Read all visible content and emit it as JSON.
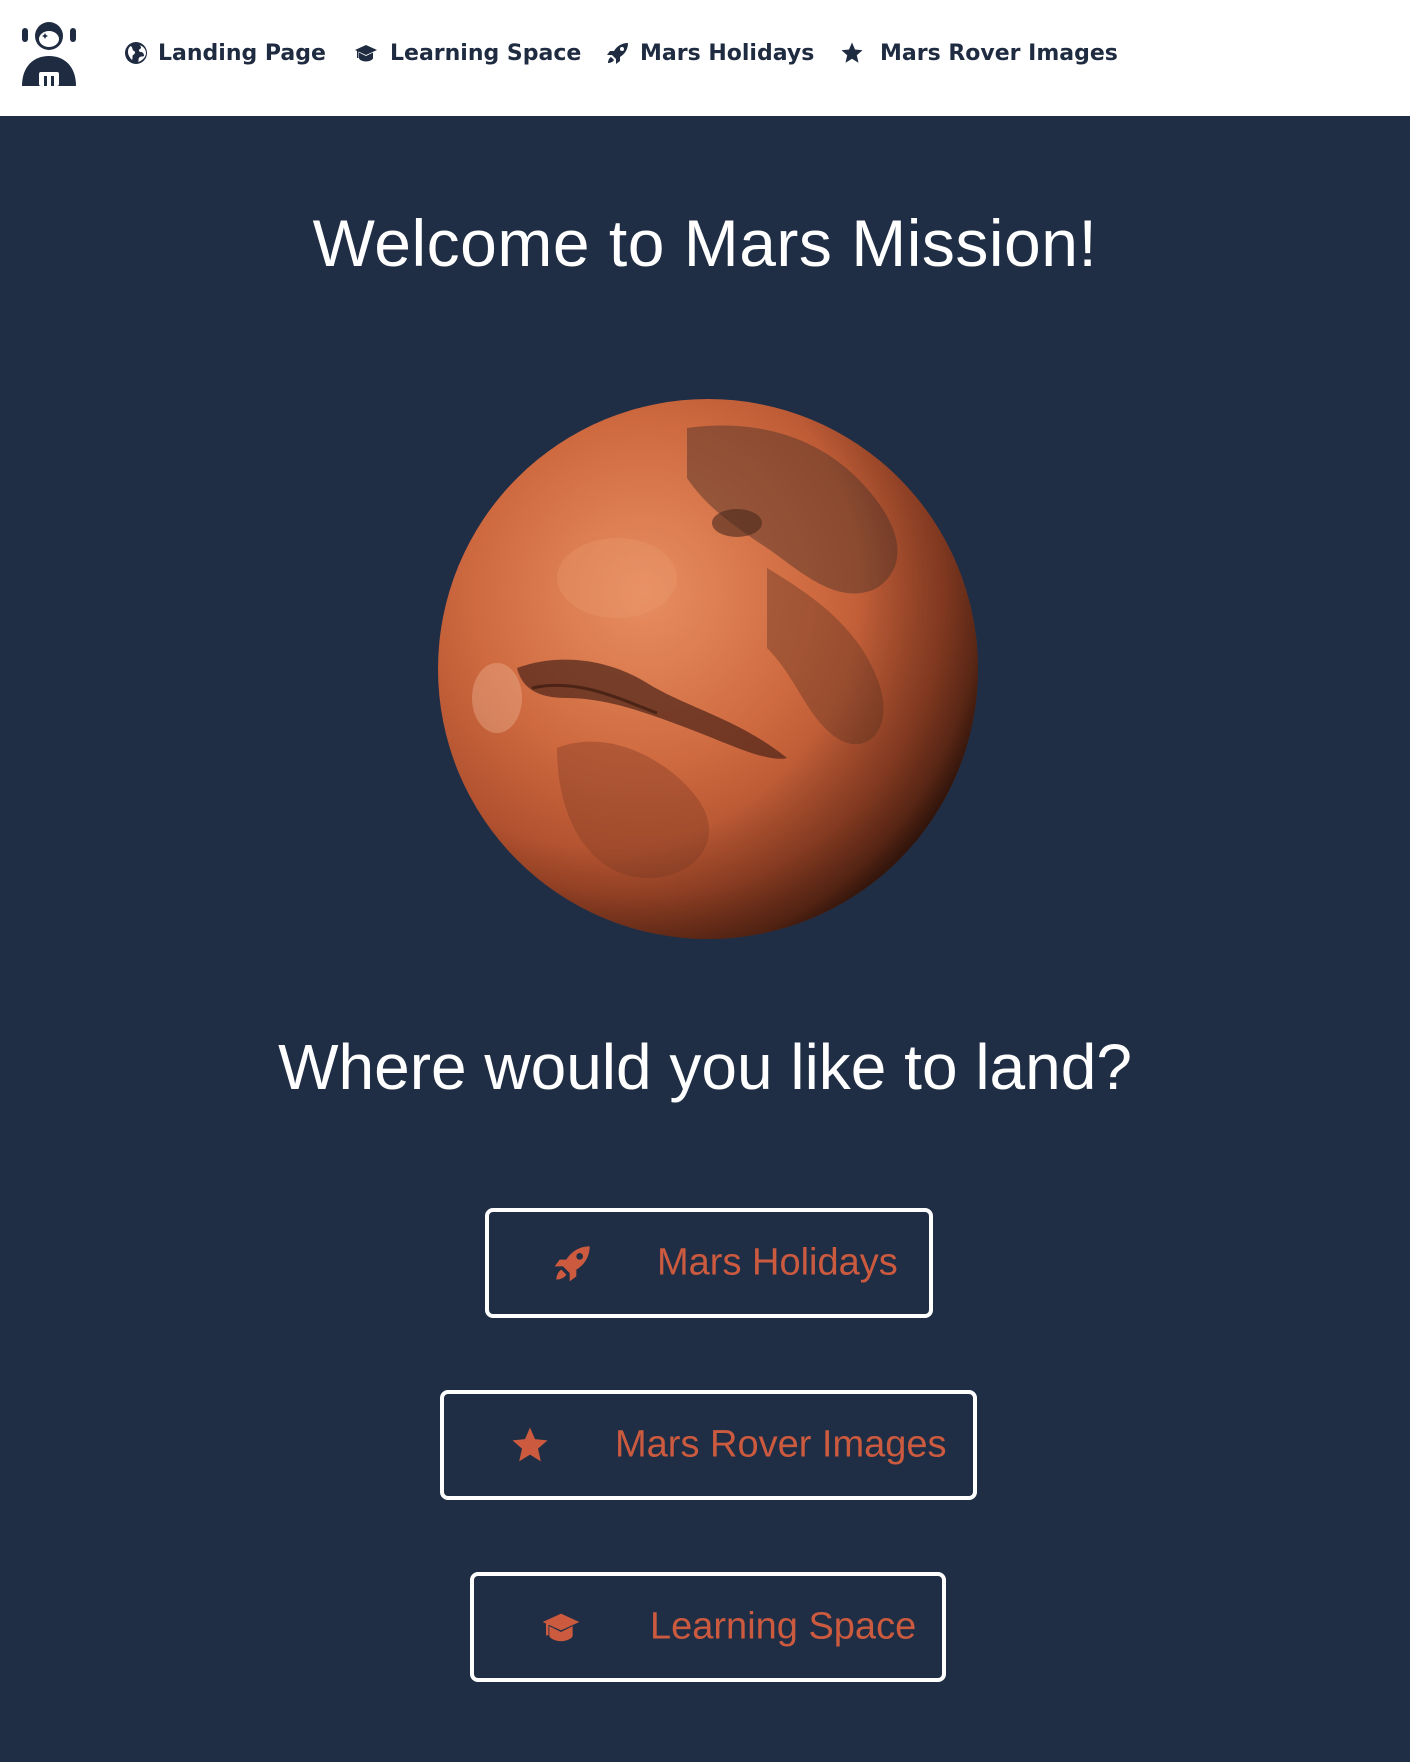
{
  "nav": {
    "logo_icon": "astronaut-icon",
    "items": [
      {
        "label": "Landing Page",
        "icon": "globe-icon"
      },
      {
        "label": "Learning Space",
        "icon": "graduation-cap-icon"
      },
      {
        "label": "Mars Holidays",
        "icon": "rocket-icon"
      },
      {
        "label": "Mars Rover Images",
        "icon": "star-icon"
      }
    ]
  },
  "hero": {
    "title": "Welcome to Mars Mission!",
    "image": "mars-planet"
  },
  "question": "Where would you like to land?",
  "destinations": [
    {
      "label": "Mars Holidays",
      "icon": "rocket-icon"
    },
    {
      "label": "Mars Rover Images",
      "icon": "star-icon"
    },
    {
      "label": "Learning Space",
      "icon": "graduation-cap-icon"
    }
  ],
  "colors": {
    "background": "#202e45",
    "navbar": "#ffffff",
    "nav_text": "#1f2b41",
    "accent": "#cc5a3f",
    "button_border": "#ffffff"
  }
}
